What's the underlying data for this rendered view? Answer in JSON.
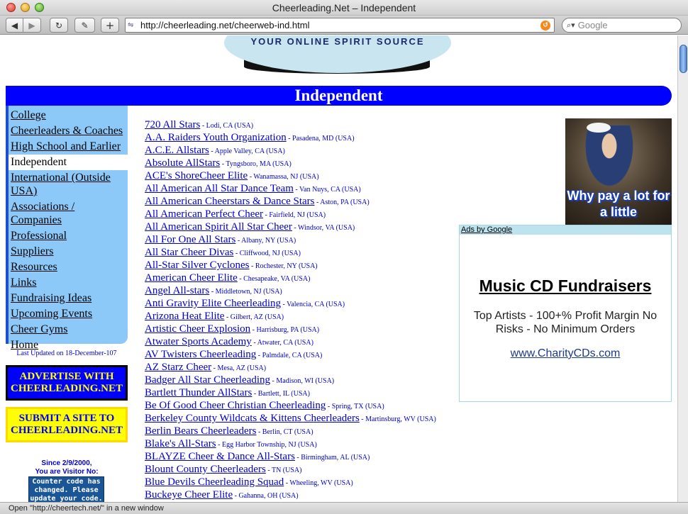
{
  "window": {
    "title": "Cheerleading.Net – Independent"
  },
  "toolbar": {
    "back_label": "◀",
    "forward_label": "▶",
    "reload_label": "C",
    "bug_label": "⌂",
    "add_label": "+",
    "url": "http://cheerleading.net/cheerweb-ind.html",
    "search_placeholder": "Google"
  },
  "logo": {
    "tagline": "YOUR ONLINE SPIRIT SOURCE"
  },
  "page": {
    "title": "Independent"
  },
  "sidebar": {
    "items": [
      {
        "label": "College"
      },
      {
        "label": "Cheerleaders & Coaches"
      },
      {
        "label": "High School and Earlier"
      },
      {
        "label": "Independent"
      },
      {
        "label": "International (Outside USA)"
      },
      {
        "label": "Associations / Companies"
      },
      {
        "label": "Professional"
      },
      {
        "label": "Suppliers"
      },
      {
        "label": "Resources"
      },
      {
        "label": "Links"
      },
      {
        "label": "Fundraising Ideas"
      },
      {
        "label": "Upcoming Events"
      },
      {
        "label": "Cheer Gyms"
      },
      {
        "label": "Home"
      }
    ],
    "current": "Independent",
    "last_updated": "Last Updated on 18-December-107"
  },
  "promos": {
    "advertise": "ADVERTISE WITH CHEERLEADING.NET",
    "submit": "SUBMIT A SITE TO CHEERLEADING.NET"
  },
  "counter": {
    "since": "Since 2/9/2000,",
    "visitor": "You are Visitor No:",
    "message": "Counter code has changed. Please update your code."
  },
  "listings": [
    {
      "name": "720 All Stars",
      "loc": " - Lodi, CA (USA)"
    },
    {
      "name": "A.A. Raiders Youth Organization",
      "loc": " - Pasadena, MD (USA)"
    },
    {
      "name": "A.C.E. Allstars",
      "loc": " - Apple Valley, CA (USA)"
    },
    {
      "name": "Absolute AllStars",
      "loc": " - Tyngsboro, MA (USA)"
    },
    {
      "name": "ACE's ShoreCheer Elite",
      "loc": " - Wanamassa, NJ (USA)"
    },
    {
      "name": "All American All Star Dance Team",
      "loc": " - Van Nuys, CA (USA)"
    },
    {
      "name": "All American Cheerstars & Dance Stars",
      "loc": " - Aston, PA (USA)"
    },
    {
      "name": "All American Perfect Cheer",
      "loc": " - Fairfield, NJ (USA)"
    },
    {
      "name": "All American Spirit All Star Cheer",
      "loc": " - Windsor, VA (USA)"
    },
    {
      "name": "All For One All Stars",
      "loc": " - Albany, NY (USA)"
    },
    {
      "name": "All Star Cheer Divas",
      "loc": " - Cliffwood, NJ (USA)"
    },
    {
      "name": "All-Star Silver Cyclones",
      "loc": " - Rochester, NY (USA)"
    },
    {
      "name": "American Cheer Elite",
      "loc": " - Chesapeake, VA (USA)"
    },
    {
      "name": "Angel All-stars",
      "loc": " - Middletown, NJ (USA)"
    },
    {
      "name": "Anti Gravity Elite Cheerleading",
      "loc": " - Valencia, CA (USA)"
    },
    {
      "name": "Arizona Heat Elite",
      "loc": " - Gilbert, AZ (USA)"
    },
    {
      "name": "Artistic Cheer Explosion",
      "loc": " - Harrisburg, PA (USA)"
    },
    {
      "name": "Atwater Sports Academy",
      "loc": " - Atwater, CA (USA)"
    },
    {
      "name": "AV Twisters Cheerleading",
      "loc": " - Palmdale, CA (USA)"
    },
    {
      "name": "AZ Starz Cheer",
      "loc": " - Mesa, AZ (USA)"
    },
    {
      "name": "Badger All Star Cheerleading",
      "loc": " - Madison, WI (USA)"
    },
    {
      "name": "Bartlett Thunder AllStars",
      "loc": " - Bartlett, IL (USA)"
    },
    {
      "name": "Be Of Good Cheer Christian Cheerleading",
      "loc": " - Spring, TX (USA)"
    },
    {
      "name": "Berkeley County Wildcats & Kittens Cheerleaders",
      "loc": " - Martinsburg, WV (USA)"
    },
    {
      "name": "Berlin Bears Cheerleaders",
      "loc": " - Berlin, CT (USA)"
    },
    {
      "name": "Blake's All-Stars",
      "loc": " - Egg Harbor Township, NJ (USA)"
    },
    {
      "name": "BLAYZE Cheer & Dance All-Stars",
      "loc": " - Birmingham, AL (USA)"
    },
    {
      "name": "Blount County Cheerleaders",
      "loc": " - TN (USA)"
    },
    {
      "name": "Blue Devils Cheerleading Squad",
      "loc": " - Wheeling, WV (USA)"
    },
    {
      "name": "Buckeye Cheer Elite",
      "loc": " - Gahanna, OH (USA)"
    }
  ],
  "ad_image": {
    "caption": "Why pay a lot for a little"
  },
  "google_ad": {
    "header": "Ads by Google",
    "title": "Music CD Fundraisers",
    "description": "Top Artists - 100+% Profit Margin No Risks - No Minimum Orders",
    "link": "www.CharityCDs.com"
  },
  "status": {
    "text": "Open \"http://cheertech.net/\" in a new window"
  }
}
